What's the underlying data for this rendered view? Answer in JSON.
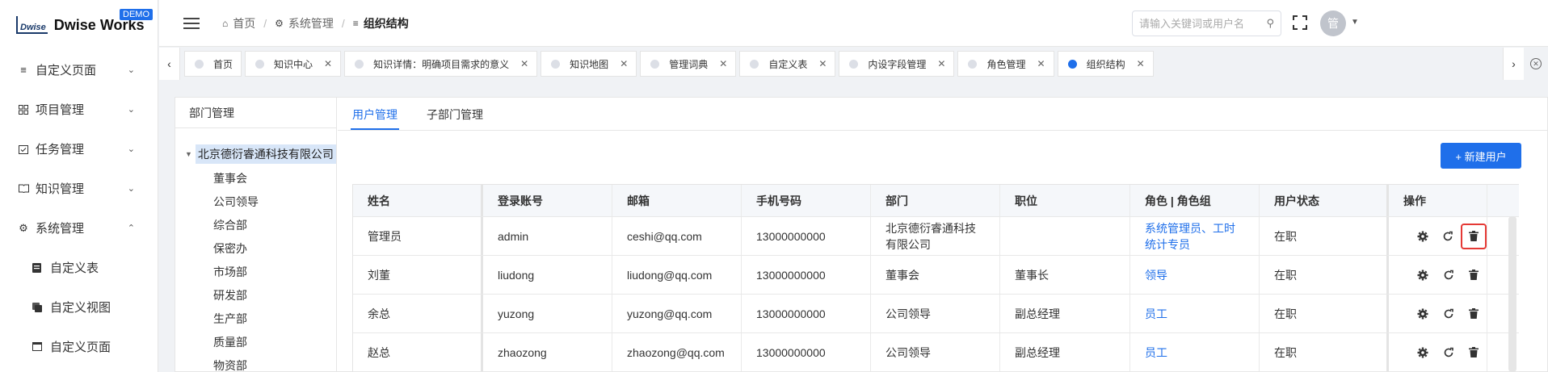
{
  "app": {
    "logo_mark": "Dwise",
    "name": "Dwise Works",
    "badge": "DEMO"
  },
  "sidebar": {
    "items": [
      {
        "label": "自定义页面",
        "icon": "list-icon",
        "expanded": false
      },
      {
        "label": "项目管理",
        "icon": "grid-icon",
        "expanded": false
      },
      {
        "label": "任务管理",
        "icon": "calendar-check-icon",
        "expanded": false
      },
      {
        "label": "知识管理",
        "icon": "book-icon",
        "expanded": false
      },
      {
        "label": "系统管理",
        "icon": "gear-icon",
        "expanded": true
      }
    ],
    "sub_items": [
      {
        "label": "自定义表",
        "icon": "table-doc-icon"
      },
      {
        "label": "自定义视图",
        "icon": "layers-icon"
      },
      {
        "label": "自定义页面",
        "icon": "window-icon"
      }
    ]
  },
  "header": {
    "breadcrumb": {
      "home": "首页",
      "system": "系统管理",
      "current": "组织结构"
    },
    "search_placeholder": "请输入关键词或用户名",
    "avatar_text": "管"
  },
  "tabs": [
    {
      "label": "首页",
      "closable": false,
      "active": false
    },
    {
      "label": "知识中心",
      "closable": true,
      "active": false
    },
    {
      "label": "知识详情：明确项目需求的意义",
      "closable": true,
      "active": false
    },
    {
      "label": "知识地图",
      "closable": true,
      "active": false
    },
    {
      "label": "管理词典",
      "closable": true,
      "active": false
    },
    {
      "label": "自定义表",
      "closable": true,
      "active": false
    },
    {
      "label": "内设字段管理",
      "closable": true,
      "active": false
    },
    {
      "label": "角色管理",
      "closable": true,
      "active": false
    },
    {
      "label": "组织结构",
      "closable": true,
      "active": true
    }
  ],
  "dept": {
    "title": "部门管理",
    "root": "北京德衍睿通科技有限公司",
    "children": [
      "董事会",
      "公司领导",
      "综合部",
      "保密办",
      "市场部",
      "研发部",
      "生产部",
      "质量部",
      "物资部"
    ]
  },
  "user_tabs": [
    "用户管理",
    "子部门管理"
  ],
  "new_user_button": "+ 新建用户",
  "table": {
    "columns": [
      "姓名",
      "登录账号",
      "邮箱",
      "手机号码",
      "部门",
      "职位",
      "角色 | 角色组",
      "用户状态",
      "操作"
    ],
    "rows": [
      {
        "name": "管理员",
        "account": "admin",
        "email": "ceshi@qq.com",
        "phone": "13000000000",
        "dept": "北京德衍睿通科技有限公司",
        "position": "",
        "role": "系统管理员、工时统计专员",
        "status": "在职"
      },
      {
        "name": "刘董",
        "account": "liudong",
        "email": "liudong@qq.com",
        "phone": "13000000000",
        "dept": "董事会",
        "position": "董事长",
        "role": "领导",
        "status": "在职"
      },
      {
        "name": "余总",
        "account": "yuzong",
        "email": "yuzong@qq.com",
        "phone": "13000000000",
        "dept": "公司领导",
        "position": "副总经理",
        "role": "员工",
        "status": "在职"
      },
      {
        "name": "赵总",
        "account": "zhaozong",
        "email": "zhaozong@qq.com",
        "phone": "13000000000",
        "dept": "公司领导",
        "position": "副总经理",
        "role": "员工",
        "status": "在职"
      }
    ]
  },
  "colors": {
    "accent": "#1f6fea",
    "highlight": "#e53935"
  }
}
